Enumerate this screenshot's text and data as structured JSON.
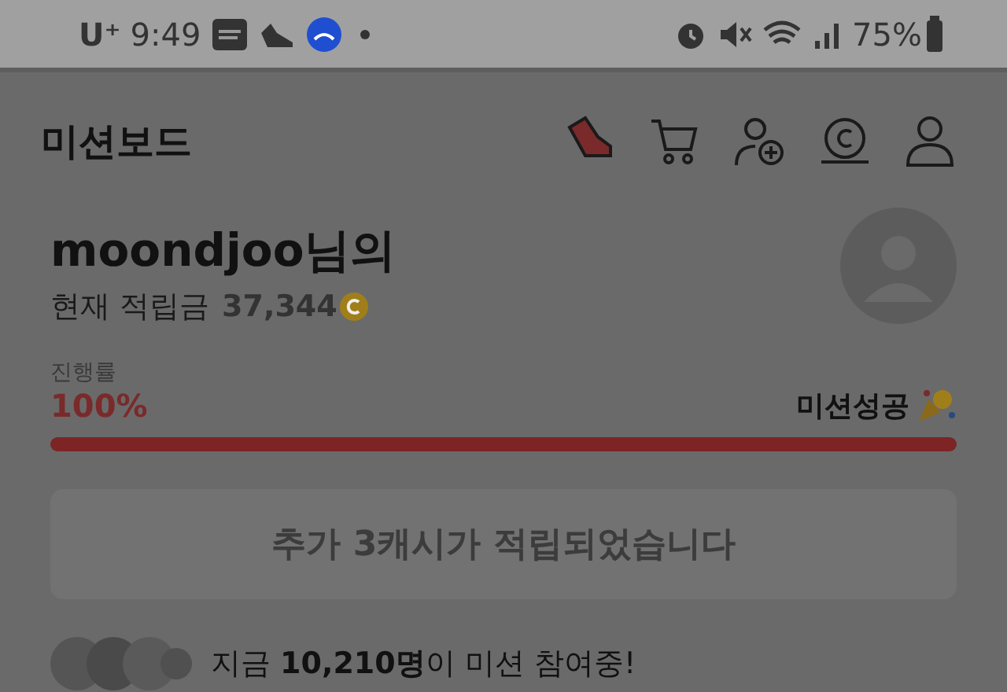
{
  "status_bar": {
    "carrier": "U⁺",
    "time": "9:49",
    "battery": "75%"
  },
  "header": {
    "title": "미션보드"
  },
  "profile": {
    "name": "moondjoo님의",
    "balance_label": "현재 적립금",
    "balance": "37,344"
  },
  "progress": {
    "label": "진행률",
    "percent": "100%",
    "status": "미션성공",
    "level": 1
  },
  "notice_button": {
    "label": "추가 3캐시가 적립되었습니다",
    "disabled": true
  },
  "participants": {
    "text": "지금 **10,210명**이 미션 참여중!"
  }
}
